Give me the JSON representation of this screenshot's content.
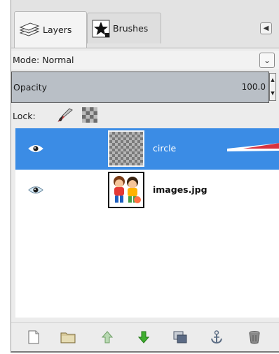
{
  "tabs": [
    {
      "label": "Layers",
      "icon": "layers-icon",
      "active": true
    },
    {
      "label": "Brushes",
      "icon": "brushes-star-icon",
      "active": false
    }
  ],
  "tab_menu_icon": "tab-menu-icon",
  "mode": {
    "label": "Mode: Normal",
    "icon": "chevron-down-icon"
  },
  "opacity": {
    "label": "Opacity",
    "value": "100.0"
  },
  "lock": {
    "label": "Lock:",
    "icons": [
      "lock-pixels-brush-icon",
      "lock-alpha-icon"
    ]
  },
  "layers": [
    {
      "name": "circle",
      "visible": true,
      "selected": true,
      "thumbnail": "transparent"
    },
    {
      "name": "images.jpg",
      "visible": true,
      "selected": false,
      "thumbnail": "cartoon-kids"
    }
  ],
  "toolbar_icons": [
    "new-layer-icon",
    "new-layer-group-icon",
    "raise-layer-icon",
    "lower-layer-icon",
    "duplicate-layer-icon",
    "anchor-layer-icon",
    "delete-layer-icon"
  ],
  "colors": {
    "selection": "#3b8ce5",
    "opacity_bar": "#b9bfc6",
    "raise_arrow": "#2e9a2e",
    "pointer": "#d8333f"
  }
}
